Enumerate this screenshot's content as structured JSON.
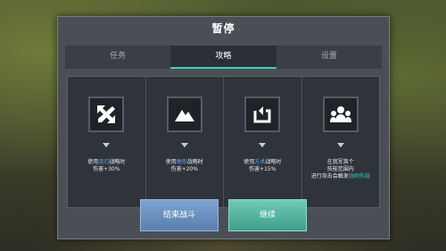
{
  "dialog": {
    "title": "暂停"
  },
  "tabs": [
    {
      "label": "任务"
    },
    {
      "label": "攻略"
    },
    {
      "label": "设置"
    }
  ],
  "strategy_cards": [
    {
      "icon": "swords-icon",
      "line1_pre": "使用",
      "line1_hl": "流刃",
      "line1_post": "战略时",
      "line2": "伤害+30%"
    },
    {
      "icon": "mountain-icon",
      "line1_pre": "使用",
      "line1_hl": "地形",
      "line1_post": "战略时",
      "line2": "伤害+20%"
    },
    {
      "icon": "cycle-icon",
      "line1_pre": "使用",
      "line1_hl": "方术",
      "line1_post": "战略时",
      "line2": "伤害+15%"
    },
    {
      "icon": "team-icon",
      "line1": "在我军首个",
      "line2": "技能范围内",
      "line3_pre": "进行攻击会触发",
      "line3_hl": "协同作战"
    }
  ],
  "buttons": {
    "end_battle": "结束战斗",
    "resume": "继续"
  },
  "colors": {
    "accent_teal": "#3fd0c0",
    "highlight_blue": "#5fb2ff"
  }
}
